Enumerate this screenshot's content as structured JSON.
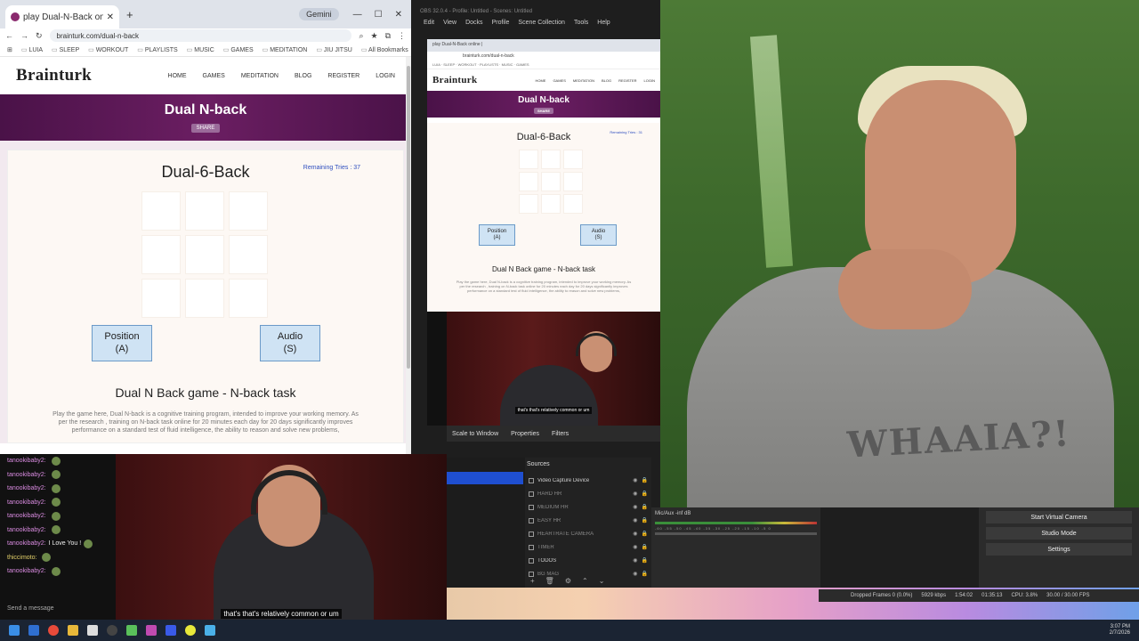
{
  "browser": {
    "tab_title": "play Dual-N-Back online |",
    "gemini_label": "Gemini",
    "url": "brainturk.com/dual-n-back",
    "bookmarks": [
      "LUIA",
      "SLEEP",
      "WORKOUT",
      "PLAYLISTS",
      "MUSIC",
      "GAMES",
      "MEDITATION",
      "JIU JITSU"
    ],
    "all_bookmarks": "All Bookmarks"
  },
  "site": {
    "logo": "Brainturk",
    "nav": [
      "HOME",
      "GAMES",
      "MEDITATION",
      "BLOG",
      "REGISTER",
      "LOGIN"
    ],
    "hero_title": "Dual N-back",
    "share_label": "SHARE",
    "game_title": "Dual-6-Back",
    "remaining_tries": "Remaining Tries : 37",
    "position_button": "Position\n(A)",
    "audio_button": "Audio\n(S)",
    "task_title": "Dual N Back game - N-back task",
    "task_desc": "Play the game here, Dual N-back is a cognitive training program, intended to improve your working memory. As per the research , training on N-back task online for 20 minutes each day for 20 days significantly improves performance on a standard test of fluid intelligence, the ability to reason and solve new problems,"
  },
  "preview": {
    "remaining_tries": "Remaining Tries : 31",
    "caption": "that's that's relatively common or um"
  },
  "obs": {
    "title": "OBS 32.0.4 - Profile: Untitled - Scenes: Untitled",
    "menu": [
      "Edit",
      "View",
      "Docks",
      "Profile",
      "Scene Collection",
      "Tools",
      "Help"
    ],
    "dock_tabs": [
      "Scale to Window",
      "Properties",
      "Filters"
    ],
    "sources_header": "Sources",
    "sources": [
      {
        "name": "Video Capture Device",
        "dim": false
      },
      {
        "name": "HARD HR",
        "dim": true
      },
      {
        "name": "MEDIUM HR",
        "dim": true
      },
      {
        "name": "EASY HR",
        "dim": true
      },
      {
        "name": "HEARTRATE CAMERA",
        "dim": true
      },
      {
        "name": "TIMER",
        "dim": true
      },
      {
        "name": "TODOS",
        "dim": false
      },
      {
        "name": "BG MAG",
        "dim": true
      }
    ],
    "audio_source": "Mic/Aux",
    "audio_level": "-inf dB",
    "meter_ticks": "-60 -55 -50 -45 -40 -35 -30 -25 -20 -15 -10 -5 0",
    "controls": [
      "Start Virtual Camera",
      "Studio Mode",
      "Settings"
    ],
    "status": {
      "dropped": "Dropped Frames 0 (0.0%)",
      "bitrate": "5929 kbps",
      "live": "1:54:02",
      "rec": "01:35:13",
      "cpu": "CPU: 3.8%",
      "fps": "30.00 / 30.00 FPS"
    }
  },
  "chat": {
    "lines": [
      {
        "user": "tanookibaby2:",
        "msg": "",
        "alt": false
      },
      {
        "user": "tanookibaby2:",
        "msg": "",
        "alt": false
      },
      {
        "user": "tanookibaby2:",
        "msg": "",
        "alt": false
      },
      {
        "user": "tanookibaby2:",
        "msg": "",
        "alt": false
      },
      {
        "user": "tanookibaby2:",
        "msg": "",
        "alt": false
      },
      {
        "user": "tanookibaby2:",
        "msg": "",
        "alt": false
      },
      {
        "user": "tanookibaby2:",
        "msg": "I Love You !",
        "alt": false
      },
      {
        "user": "thiccimoto:",
        "msg": "",
        "alt": true
      },
      {
        "user": "tanookibaby2:",
        "msg": "",
        "alt": false
      }
    ],
    "input_placeholder": "Send a message",
    "caption": "that's that's relatively common or um"
  },
  "webcam": {
    "shirt_text": "WHAAIA?!"
  },
  "tray": {
    "time": "3:07 PM",
    "date": "2/7/2026"
  }
}
